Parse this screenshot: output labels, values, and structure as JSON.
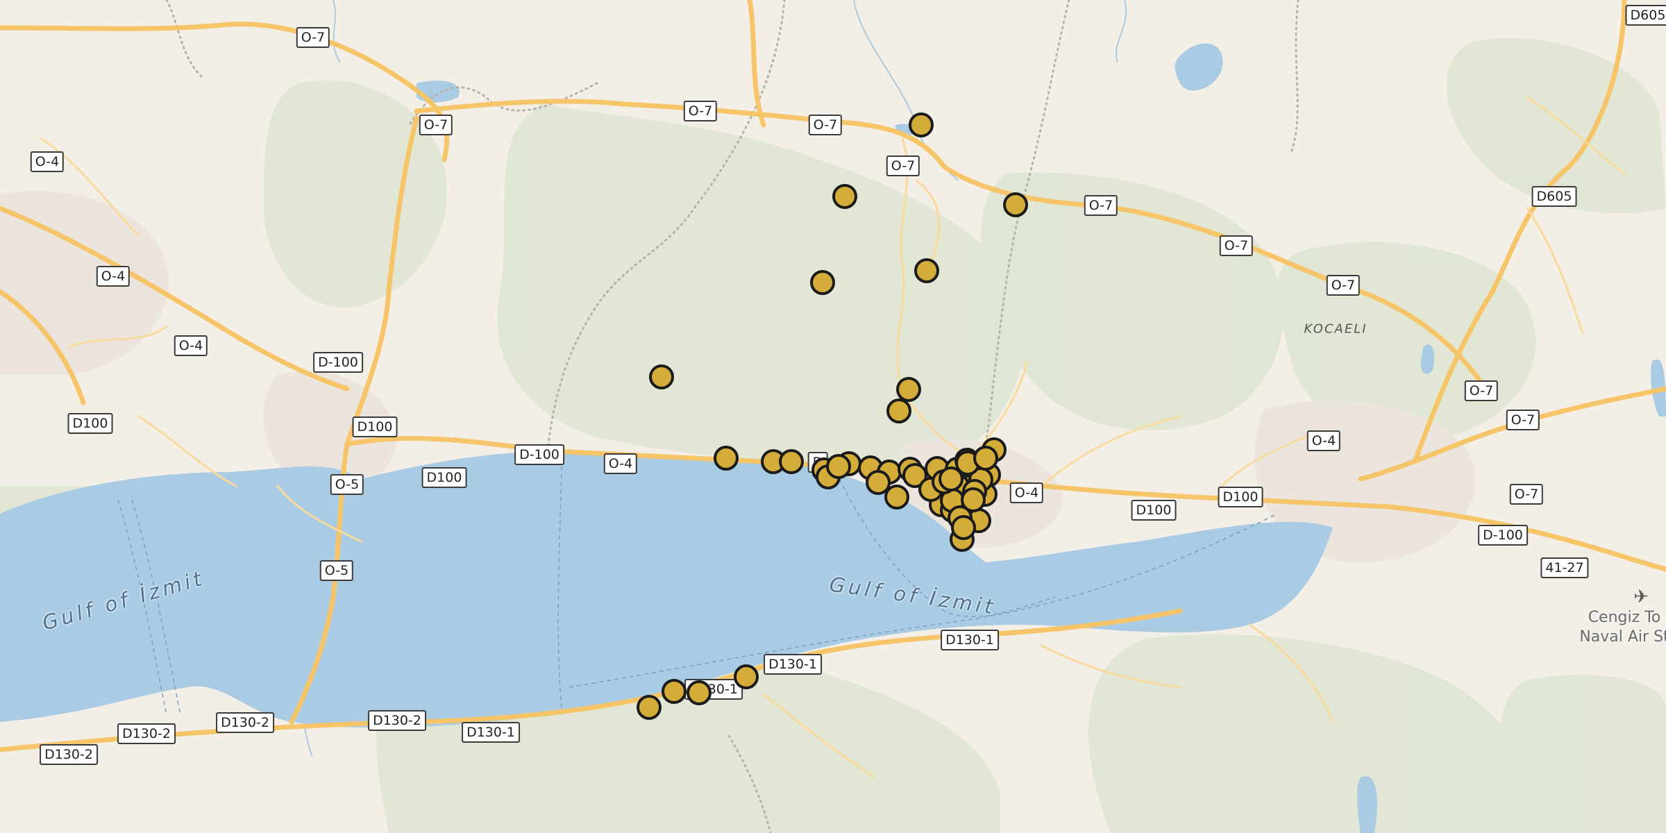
{
  "map": {
    "water_color": "#a9cbe3",
    "land_color": "#f3efe7",
    "forest_color": "#dfe6d2",
    "road_color": "#f6c56a",
    "marker_color": "#d4ac3a",
    "marker_outline": "#1b1b1b"
  },
  "labels": {
    "gulf_west": "Gulf of İzmit",
    "gulf_center": "Gulf of İzmit",
    "region": "KOCAELI",
    "airport_line1": "Cengiz To",
    "airport_line2": "Naval Air St"
  },
  "road_shields": [
    "O-7",
    "O-7",
    "O-7",
    "O-7",
    "O-7",
    "O-7",
    "O-7",
    "O-7",
    "O-7",
    "O-7",
    "O-7",
    "O-4",
    "O-4",
    "O-4",
    "O-4",
    "O-4",
    "O-4",
    "D-100",
    "D100",
    "D100",
    "D-100",
    "D100",
    "D100",
    "D-100",
    "D100",
    "O-5",
    "O-5",
    "D130-2",
    "D130-2",
    "D130-2",
    "D130-2",
    "D130-1",
    "D130-1",
    "D130-1",
    "D130-1",
    "D605",
    "D605",
    "41-27",
    "D"
  ],
  "markers_count": 52
}
